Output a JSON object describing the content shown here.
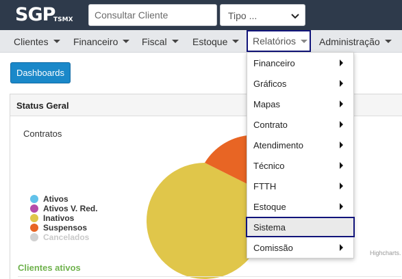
{
  "header": {
    "logo": "SGP",
    "logo_sub": "TSMX",
    "search_placeholder": "Consultar Cliente",
    "tipo_label": "Tipo ..."
  },
  "nav": {
    "items": [
      {
        "label": "Clientes"
      },
      {
        "label": "Financeiro"
      },
      {
        "label": "Fiscal"
      },
      {
        "label": "Estoque"
      },
      {
        "label": "Relatórios"
      },
      {
        "label": "Administração"
      }
    ]
  },
  "dashboards_label": "Dashboards",
  "panel": {
    "title": "Status Geral",
    "chart_title": "Contratos",
    "credits": "Highcharts.",
    "section_title": "Clientes ativos"
  },
  "chart_data": {
    "type": "pie",
    "title": "Contratos",
    "legend_position": "left",
    "series": [
      {
        "name": "Ativos",
        "color": "#62c2ea"
      },
      {
        "name": "Ativos V. Red.",
        "color": "#b54caa"
      },
      {
        "name": "Inativos",
        "color": "#e0c64a"
      },
      {
        "name": "Suspensos",
        "color": "#e86524"
      },
      {
        "name": "Cancelados",
        "color": "#d1d1d1",
        "hidden": true
      }
    ]
  },
  "dropdown": {
    "items": [
      {
        "label": "Financeiro",
        "submenu": true
      },
      {
        "label": "Gráficos",
        "submenu": true
      },
      {
        "label": "Mapas",
        "submenu": true
      },
      {
        "label": "Contrato",
        "submenu": true
      },
      {
        "label": "Atendimento",
        "submenu": true
      },
      {
        "label": "Técnico",
        "submenu": true
      },
      {
        "label": "FTTH",
        "submenu": true
      },
      {
        "label": "Estoque",
        "submenu": true
      },
      {
        "label": "Sistema",
        "submenu": false,
        "highlighted": true
      },
      {
        "label": "Comissão",
        "submenu": true
      }
    ]
  }
}
